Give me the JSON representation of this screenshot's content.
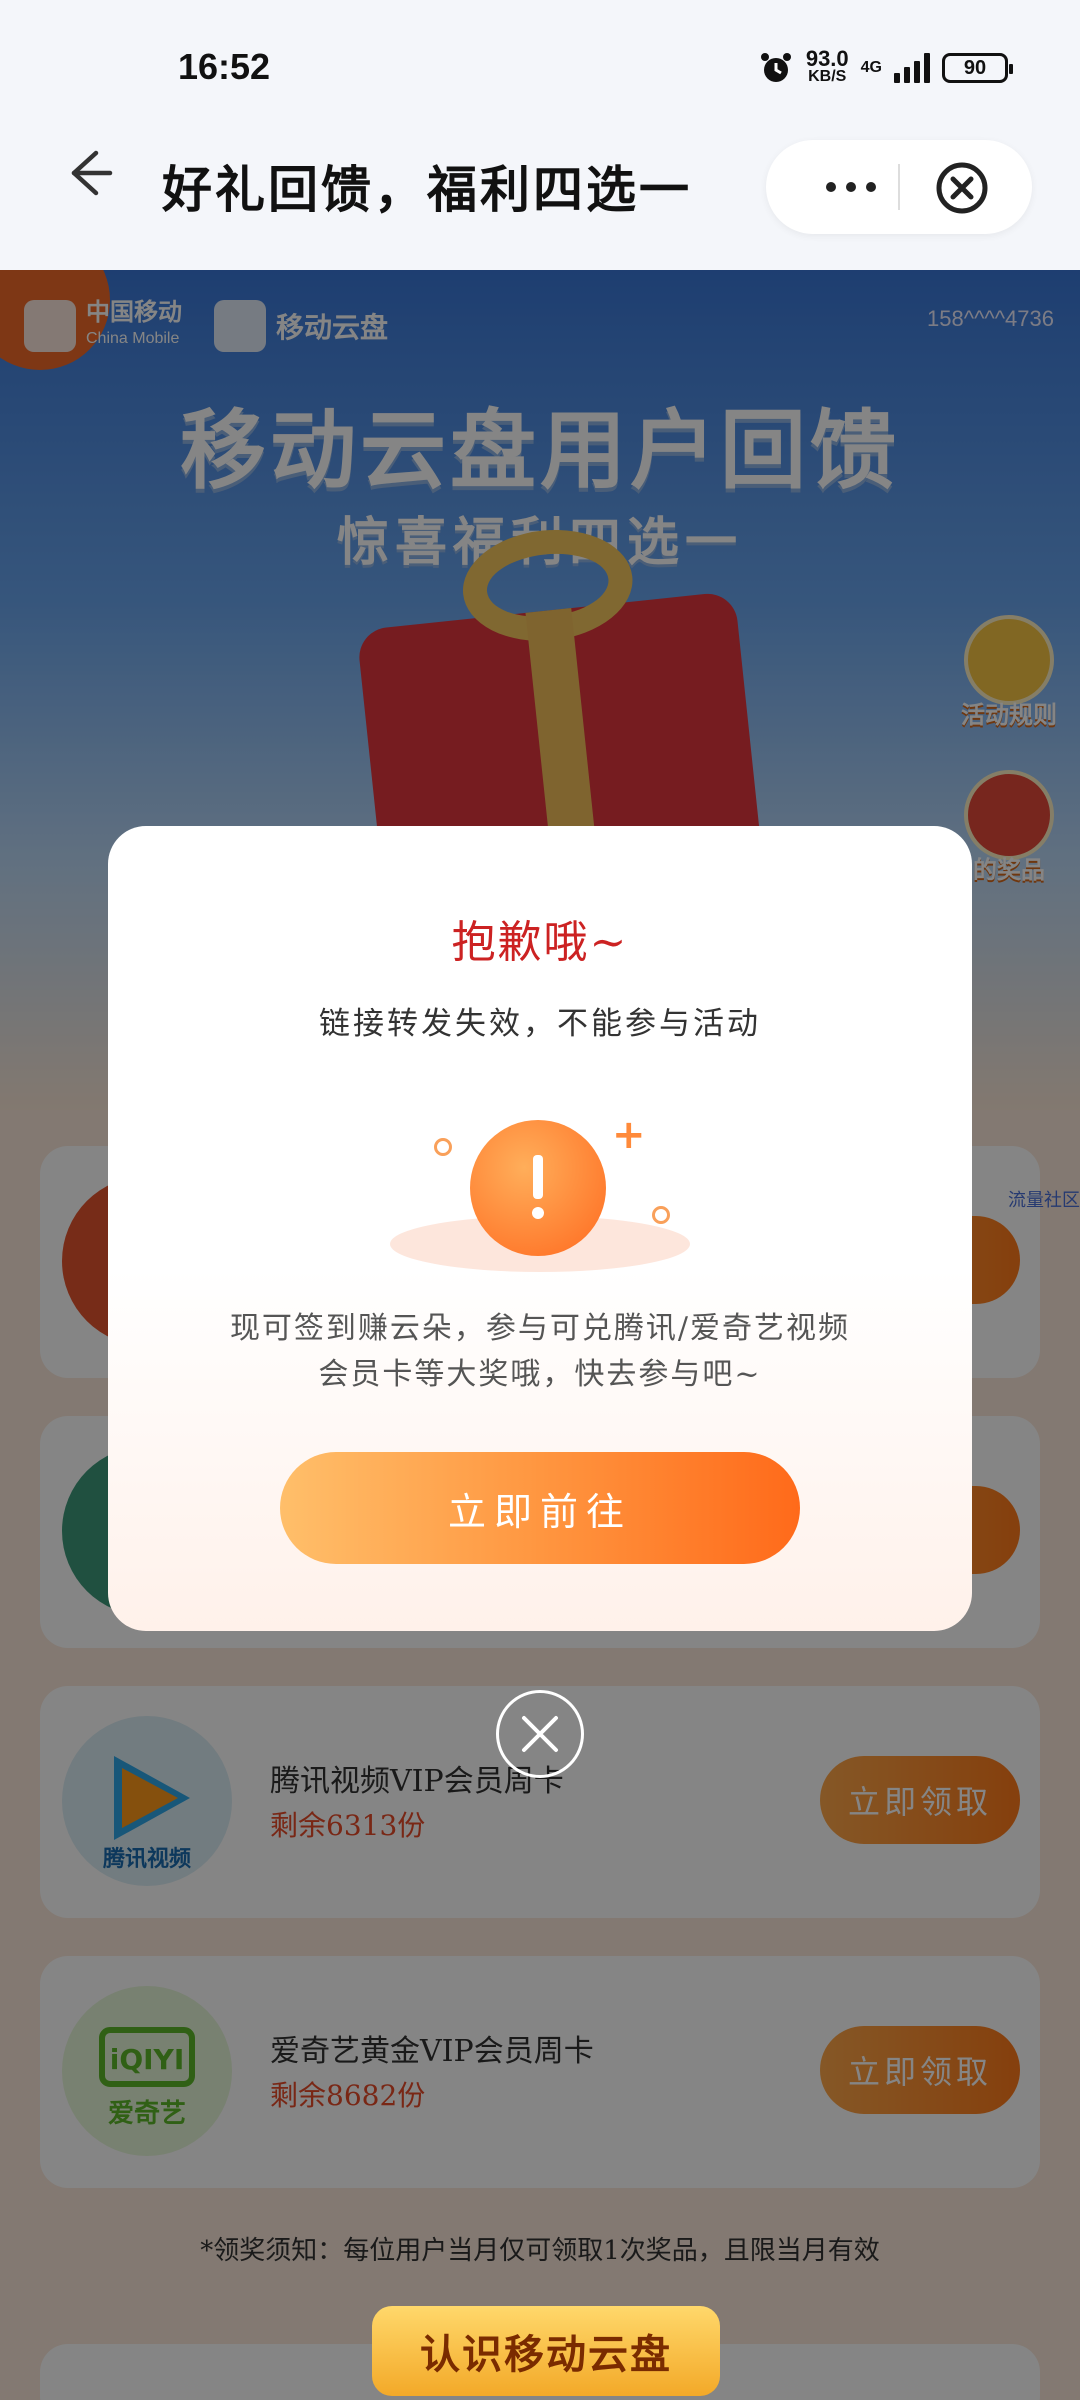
{
  "status_bar": {
    "time": "16:52",
    "net_speed_value": "93.0",
    "net_speed_unit": "KB/S",
    "network": "4G",
    "battery": "90"
  },
  "title_bar": {
    "title": "好礼回馈，福利四选一",
    "back_icon": "arrow-left-icon",
    "more_icon": "more-dots-icon",
    "close_icon": "close-circle-icon"
  },
  "hero": {
    "brand1_cn": "中国移动",
    "brand1_en": "China Mobile",
    "brand2": "移动云盘",
    "phone_masked": "158^^^^4736",
    "title": "移动云盘用户回馈",
    "subtitle": "惊喜福利四选一",
    "side_buttons": [
      {
        "label": "活动规则"
      },
      {
        "label": "的奖品"
      }
    ]
  },
  "rewards": [
    {
      "title": "",
      "remain": "",
      "button": "取"
    },
    {
      "title": "",
      "remain": "",
      "button": "取"
    },
    {
      "title": "腾讯视频VIP会员周卡",
      "remain": "剩余6313份",
      "button": "立即领取",
      "icon_label": "腾讯视频"
    },
    {
      "title": "爱奇艺黄金VIP会员周卡",
      "remain": "剩余8682份",
      "button": "立即领取",
      "icon_label": "爱奇艺"
    }
  ],
  "notice": "*领奖须知：每位用户当月仅可领取1次奖品，且限当月有效",
  "learn_button": "认识移动云盘",
  "side_link": "流量社区",
  "dialog": {
    "title": "抱歉哦~",
    "desc": "链接转发失效，不能参与活动",
    "body_line1": "现可签到赚云朵，参与可兑腾讯/爱奇艺视频",
    "body_line2": "会员卡等大奖哦，快去参与吧~",
    "button": "立即前往",
    "close_icon": "close-icon",
    "warning_icon": "exclamation-icon"
  },
  "colors": {
    "accent_orange": "#ff7a1a",
    "title_red": "#cc2222",
    "remain_red": "#e84b2a"
  }
}
